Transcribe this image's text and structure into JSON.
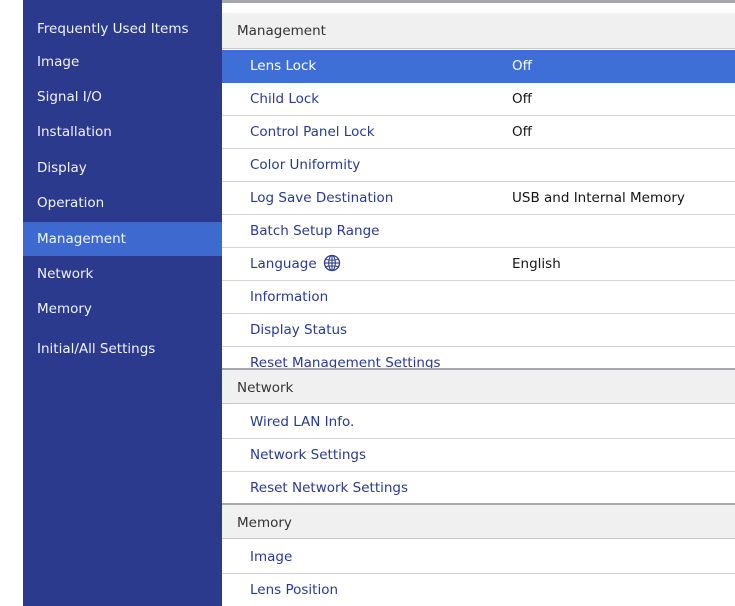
{
  "colors": {
    "sidebar_bg": "#2b3a8c",
    "sidebar_active": "#3e6ad0",
    "row_selected": "#3d6fd6",
    "row_label": "#2a3a8c",
    "section_header_bg": "#f0f0f1"
  },
  "sidebar": {
    "items": [
      {
        "label": "Frequently Used Items"
      },
      {
        "label": "Image"
      },
      {
        "label": "Signal I/O"
      },
      {
        "label": "Installation"
      },
      {
        "label": "Display"
      },
      {
        "label": "Operation"
      },
      {
        "label": "Management",
        "active": true
      },
      {
        "label": "Network"
      },
      {
        "label": "Memory"
      },
      {
        "label": "Initial/All Settings"
      }
    ]
  },
  "management": {
    "header": "Management",
    "rows": [
      {
        "label": "Lens Lock",
        "value": "Off",
        "selected": true
      },
      {
        "label": "Child Lock",
        "value": "Off"
      },
      {
        "label": "Control Panel Lock",
        "value": "Off"
      },
      {
        "label": "Color Uniformity",
        "value": ""
      },
      {
        "label": "Log Save Destination",
        "value": "USB and Internal Memory"
      },
      {
        "label": "Batch Setup Range",
        "value": ""
      },
      {
        "label": "Language",
        "value": "English",
        "icon": "globe-icon"
      },
      {
        "label": "Information",
        "value": ""
      },
      {
        "label": "Display Status",
        "value": ""
      },
      {
        "label": "Reset Management Settings",
        "value": ""
      }
    ]
  },
  "network": {
    "header": "Network",
    "rows": [
      {
        "label": "Wired LAN Info."
      },
      {
        "label": "Network Settings"
      },
      {
        "label": "Reset Network Settings"
      }
    ]
  },
  "memory": {
    "header": "Memory",
    "rows": [
      {
        "label": "Image"
      },
      {
        "label": "Lens Position"
      }
    ]
  }
}
